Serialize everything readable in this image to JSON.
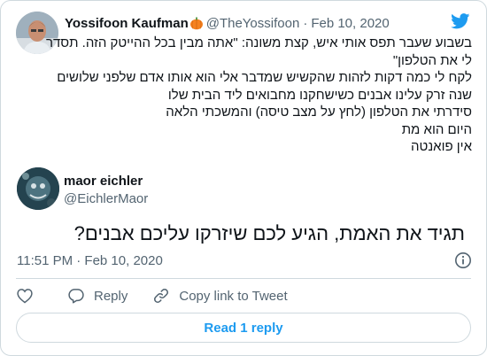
{
  "quoted": {
    "name": "Yossifoon Kaufman",
    "handle": "@TheYossifoon",
    "separator": "·",
    "date": "Feb 10, 2020",
    "lines": [
      "בשבוע שעבר תפס אותי איש, קצת משונה: \"אתה מבין בכל ההייטק הזה. תסדר",
      "לי את הטלפון\"",
      "לקח לי כמה דקות לזהות שהקשיש שמדבר אלי הוא אותו אדם שלפני שלושים",
      "שנה זרק עלינו אבנים כשישחקנו מחבואים ליד הבית שלו",
      "סידרתי את הטלפון (לחץ על מצב טיסה) והמשכתי הלאה",
      "היום הוא מת",
      "אין פואנטה"
    ]
  },
  "tweet": {
    "name": "maor eichler",
    "handle": "@EichlerMaor",
    "text": "תגיד את האמת, הגיע לכם שיזרקו עליכם אבנים?",
    "timestamp": "11:51 PM · Feb 10, 2020"
  },
  "actions": {
    "reply_label": "Reply",
    "copy_label": "Copy link to Tweet"
  },
  "read_replies_label": "Read 1 reply",
  "colors": {
    "brand": "#1d9bf0",
    "like_icon": "#536471",
    "muted": "#536471",
    "border": "#cfd9de"
  },
  "icons": [
    "twitter-bird-icon",
    "pumpkin-emoji-icon",
    "info-icon",
    "heart-icon",
    "reply-icon",
    "link-icon"
  ]
}
